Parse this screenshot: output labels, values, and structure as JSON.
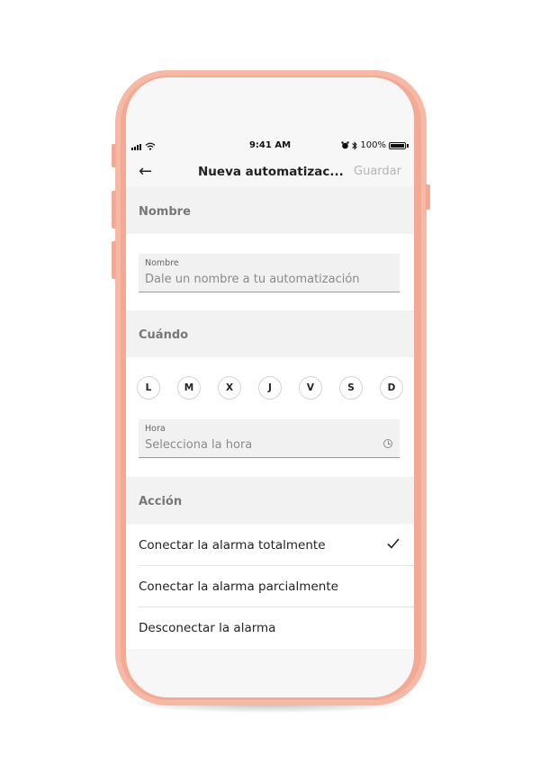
{
  "status_bar": {
    "time": "9:41 AM",
    "battery": "100%"
  },
  "header": {
    "title": "Nueva automatizac...",
    "save_label": "Guardar"
  },
  "sections": {
    "nombre": "Nombre",
    "cuando": "Cuándo",
    "accion": "Acción"
  },
  "name_field": {
    "label": "Nombre",
    "placeholder": "Dale un nombre a tu automatización"
  },
  "days": [
    "L",
    "M",
    "X",
    "J",
    "V",
    "S",
    "D"
  ],
  "time_field": {
    "label": "Hora",
    "placeholder": "Selecciona la hora"
  },
  "actions": [
    {
      "label": "Conectar la alarma totalmente",
      "selected": true
    },
    {
      "label": "Conectar la alarma parcialmente",
      "selected": false
    },
    {
      "label": "Desconectar la alarma",
      "selected": false
    }
  ],
  "icons": {
    "back": "arrow-left-icon",
    "time": "clock-icon",
    "selected": "check-icon"
  },
  "colors": {
    "phone_frame": "#f3a994",
    "section_bg": "#f2f2f2",
    "field_bg": "#f1f1f1"
  }
}
